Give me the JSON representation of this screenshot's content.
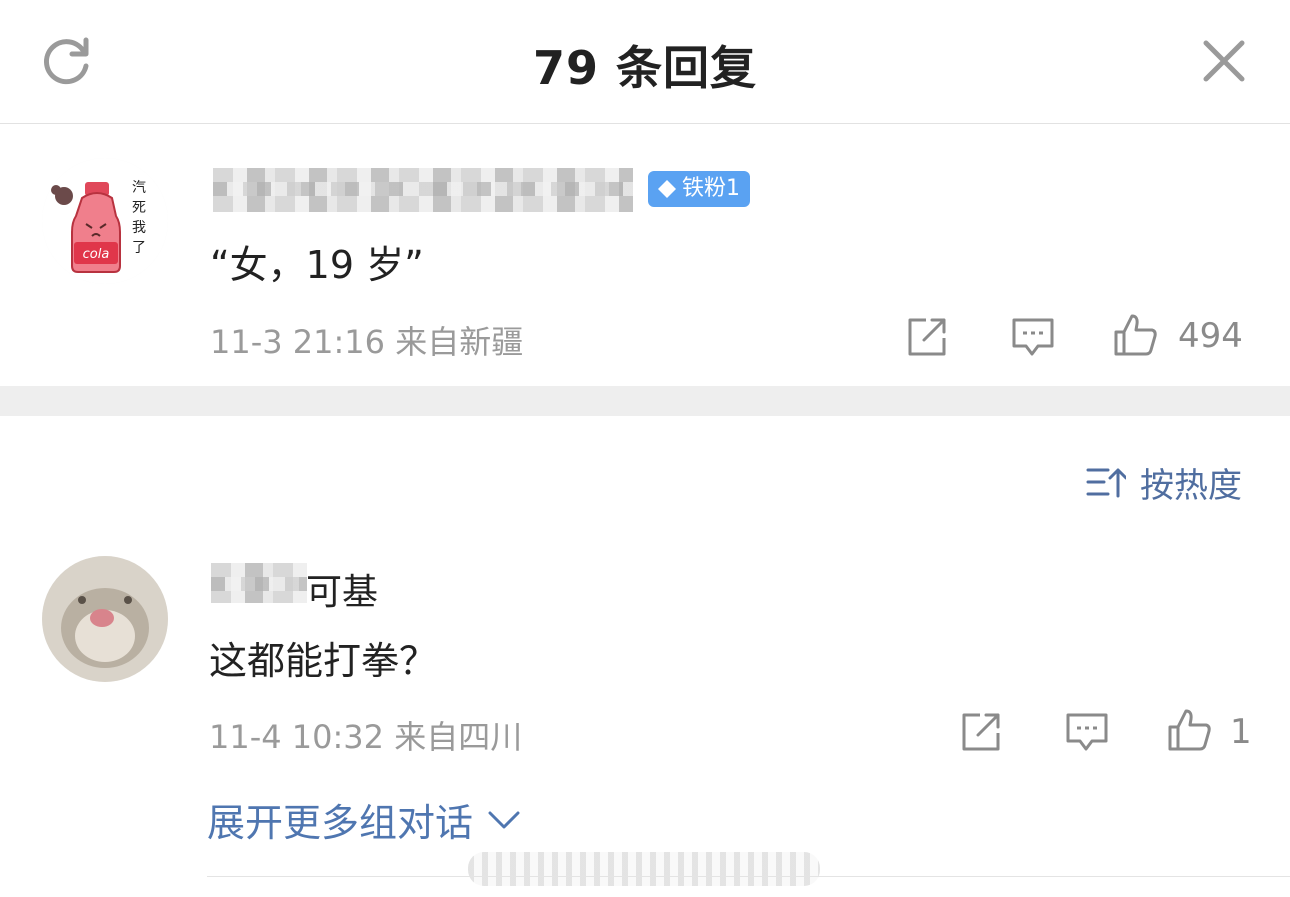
{
  "header": {
    "title": "79 条回复",
    "refresh_icon": "refresh-icon",
    "close_icon": "close-icon"
  },
  "main_comment": {
    "avatar_text": "汽死我了",
    "avatar_label": "cola",
    "badge": "铁粉1",
    "text": "“女，19 岁”",
    "meta": "11-3 21:16  来自新疆",
    "likes": "494"
  },
  "sort": {
    "label": "按热度"
  },
  "replies": [
    {
      "name_visible": "可基",
      "text": "这都能打拳？",
      "meta": "11-4 10:32  来自四川",
      "likes": "1"
    }
  ],
  "expand_label": "展开更多组对话",
  "colors": {
    "accent_link": "#4f76b0",
    "badge_bg": "#5aa2f2",
    "meta_gray": "#9a9a9a",
    "band_gray": "#eeeeee"
  }
}
